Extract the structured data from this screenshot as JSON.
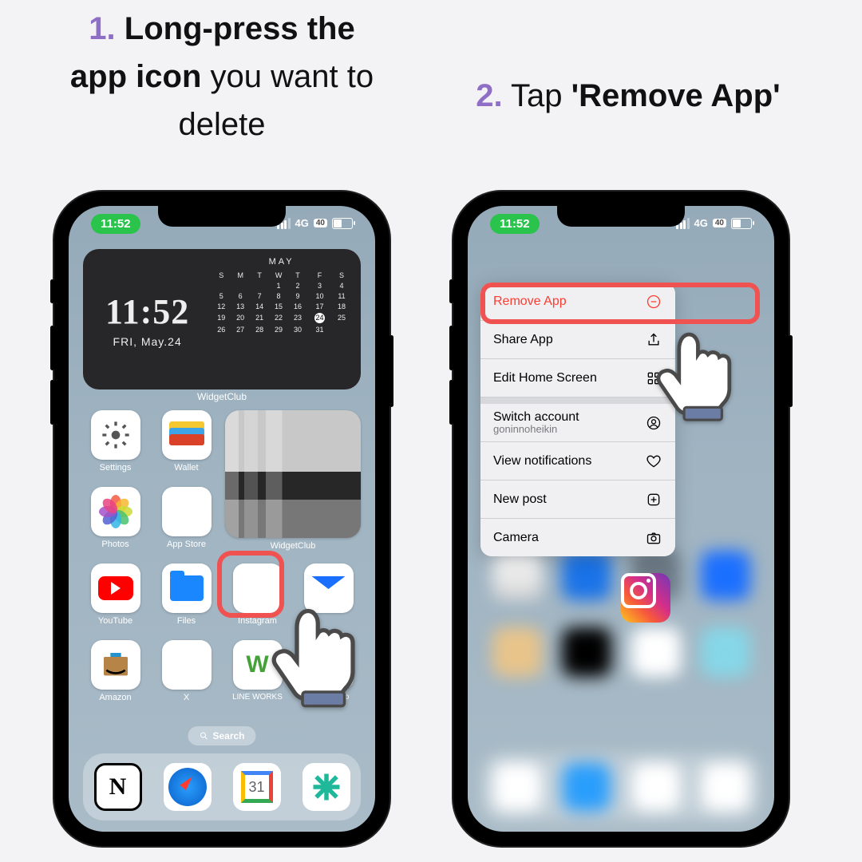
{
  "steps": {
    "s1_num": "1.",
    "s1_bold1": "Long-press the",
    "s1_bold2": "app icon",
    "s1_rest": " you want to delete",
    "s2_num": "2.",
    "s2_plain": " Tap ",
    "s2_bold": "'Remove App'"
  },
  "status": {
    "time": "11:52",
    "net": "4G",
    "batt": "40"
  },
  "widget": {
    "time": "11:52",
    "date": "FRI, May.24",
    "month": "MAY",
    "dow": [
      "S",
      "M",
      "T",
      "W",
      "T",
      "F",
      "S"
    ],
    "weeks": [
      [
        "",
        "",
        "",
        "1",
        "2",
        "3",
        "4"
      ],
      [
        "5",
        "6",
        "7",
        "8",
        "9",
        "10",
        "11"
      ],
      [
        "12",
        "13",
        "14",
        "15",
        "16",
        "17",
        "18"
      ],
      [
        "19",
        "20",
        "21",
        "22",
        "23",
        "24",
        "25"
      ],
      [
        "26",
        "27",
        "28",
        "29",
        "30",
        "31",
        ""
      ]
    ],
    "today": "24",
    "label": "WidgetClub"
  },
  "apps": {
    "settings": "Settings",
    "wallet": "Wallet",
    "photo_widget": "WidgetClub",
    "photos": "Photos",
    "appstore": "App Store",
    "youtube": "YouTube",
    "files": "Files",
    "instagram": "Instagram",
    "mail": "Mail",
    "amazon": "Amazon",
    "x": "X",
    "lineworks": "LINE WORKS",
    "widgetclub": "WidgetClub"
  },
  "search": "Search",
  "dock": {
    "gcal_num": "31"
  },
  "menu": {
    "remove": "Remove App",
    "share": "Share App",
    "edit": "Edit Home Screen",
    "switch": "Switch account",
    "switch_sub": "goninnoheikin",
    "notifs": "View notifications",
    "newpost": "New post",
    "camera": "Camera"
  }
}
